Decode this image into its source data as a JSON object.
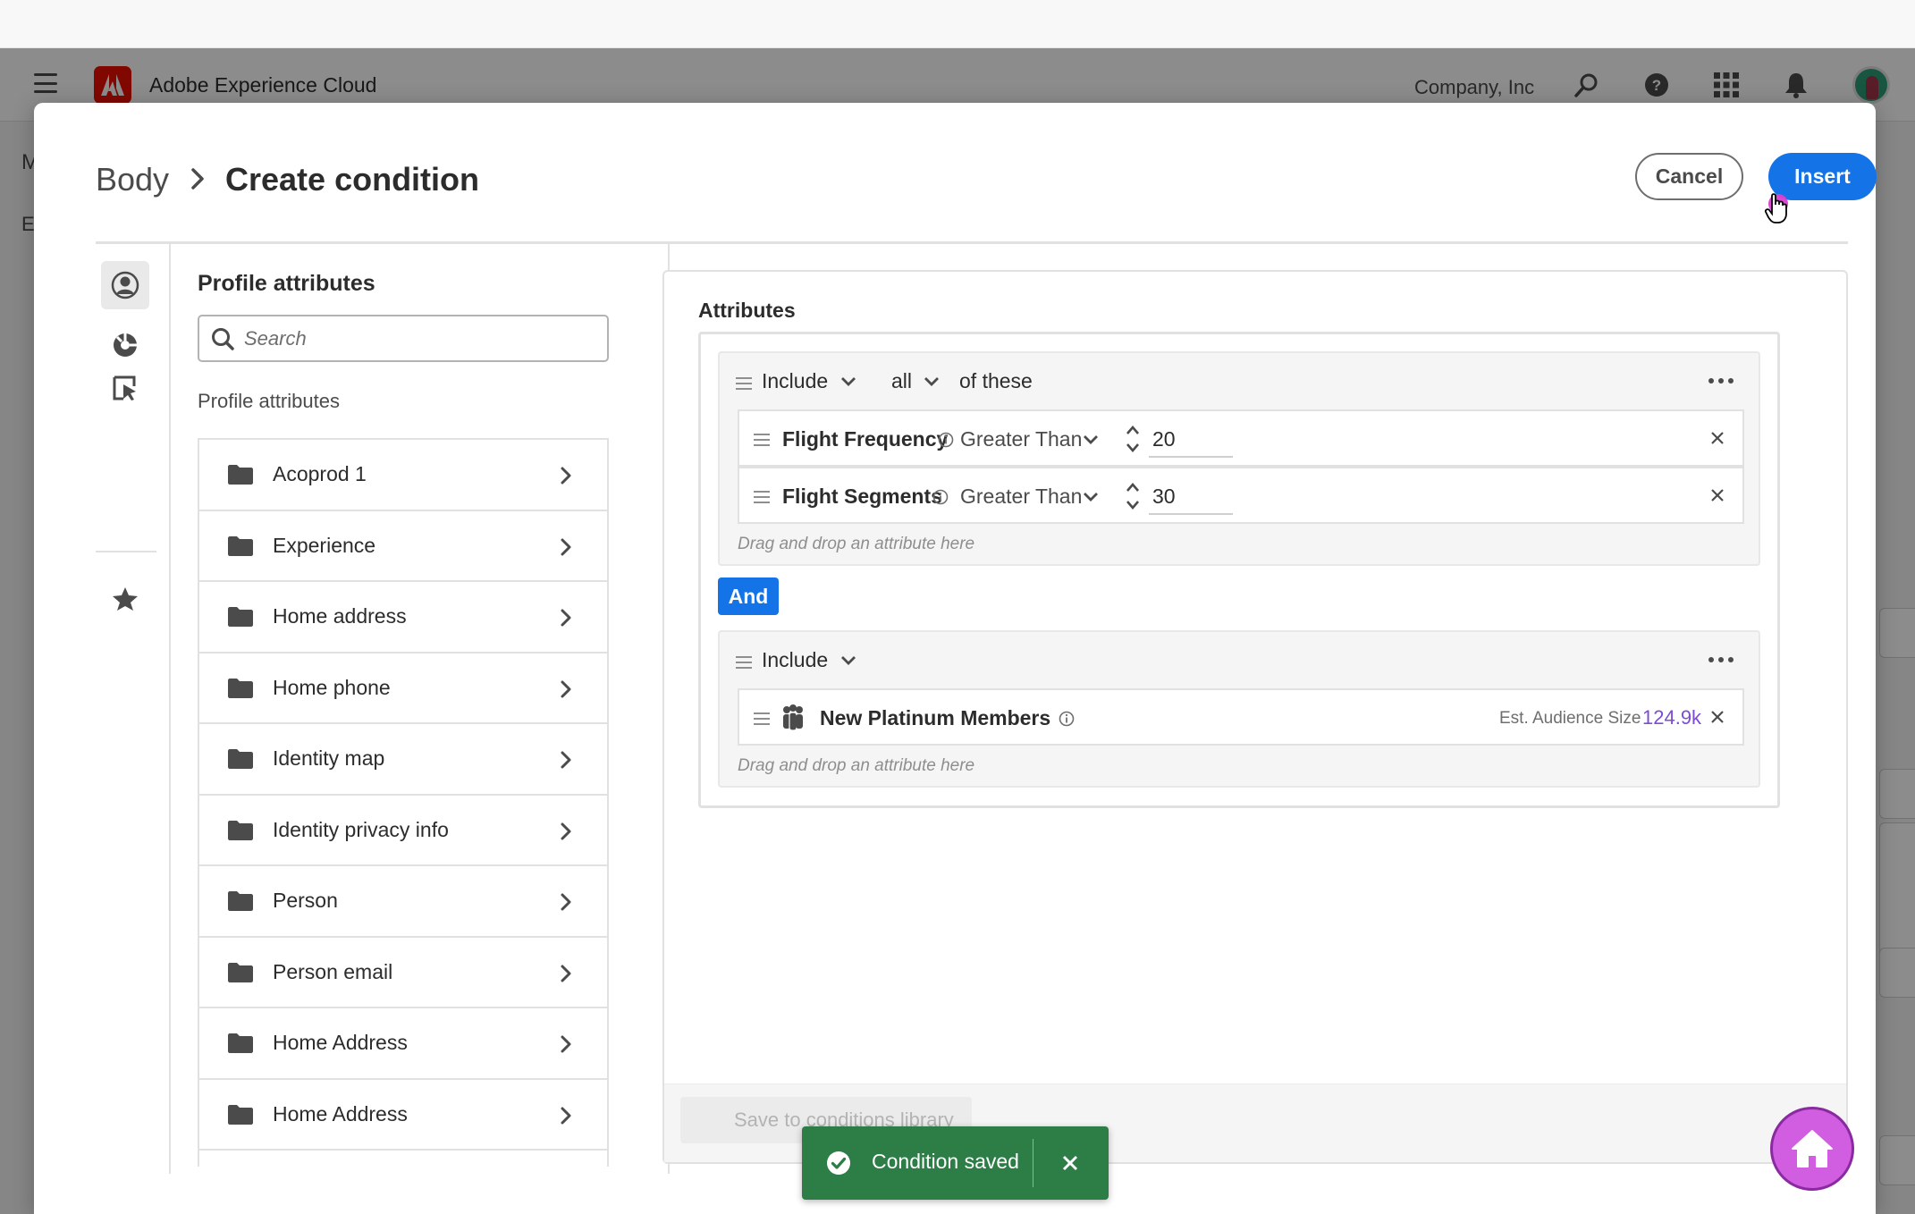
{
  "shell": {
    "app_title": "Adobe Experience Cloud",
    "org_name": "Company, Inc",
    "left_fragment_1": "M",
    "left_fragment_2": "E",
    "icons": [
      "menu-icon",
      "adobe-logo",
      "search-icon",
      "help-icon",
      "apps-grid-icon",
      "bell-icon",
      "avatar"
    ]
  },
  "dialog": {
    "breadcrumb_parent": "Body",
    "title": "Create condition",
    "cancel_label": "Cancel",
    "insert_label": "Insert"
  },
  "rail": {
    "items": [
      {
        "name": "profile-attributes",
        "icon": "user-circle-icon",
        "active": true
      },
      {
        "name": "audiences",
        "icon": "audience-icon",
        "active": false
      },
      {
        "name": "context",
        "icon": "select-pointer-icon",
        "active": false
      },
      {
        "name": "favorites",
        "icon": "star-icon",
        "active": false
      }
    ],
    "expand_icon": "chevron-double-right-icon"
  },
  "panel": {
    "title": "Profile attributes",
    "search_placeholder": "Search",
    "section_label": "Profile attributes",
    "items": [
      {
        "label": "Acoprod 1"
      },
      {
        "label": "Experience"
      },
      {
        "label": "Home address"
      },
      {
        "label": "Home phone"
      },
      {
        "label": "Identity map"
      },
      {
        "label": "Identity privacy info"
      },
      {
        "label": "Person"
      },
      {
        "label": "Person email"
      },
      {
        "label": "Home Address"
      },
      {
        "label": "Home Address"
      }
    ]
  },
  "canvas": {
    "title": "Attributes",
    "group1": {
      "include_label": "Include",
      "quantifier": "all",
      "suffix": "of these",
      "conditions": [
        {
          "name": "Flight Frequency",
          "operator": "Greater Than",
          "value": "20"
        },
        {
          "name": "Flight Segments",
          "operator": "Greater Than",
          "value": "30"
        }
      ],
      "drop_hint": "Drag and drop an attribute here"
    },
    "combinator": "And",
    "group2": {
      "include_label": "Include",
      "audience": {
        "name": "New Platinum Members",
        "est_label": "Est. Audience Size",
        "est_value": "124.9k"
      },
      "drop_hint": "Drag and drop an attribute here"
    },
    "save_library_label": "Save to conditions library"
  },
  "toast": {
    "message": "Condition saved",
    "status_color": "#2d7d46"
  },
  "colors": {
    "accent": "#1473e6",
    "audience_value": "#7e4bd4",
    "home_fab": "#d15ee0"
  }
}
